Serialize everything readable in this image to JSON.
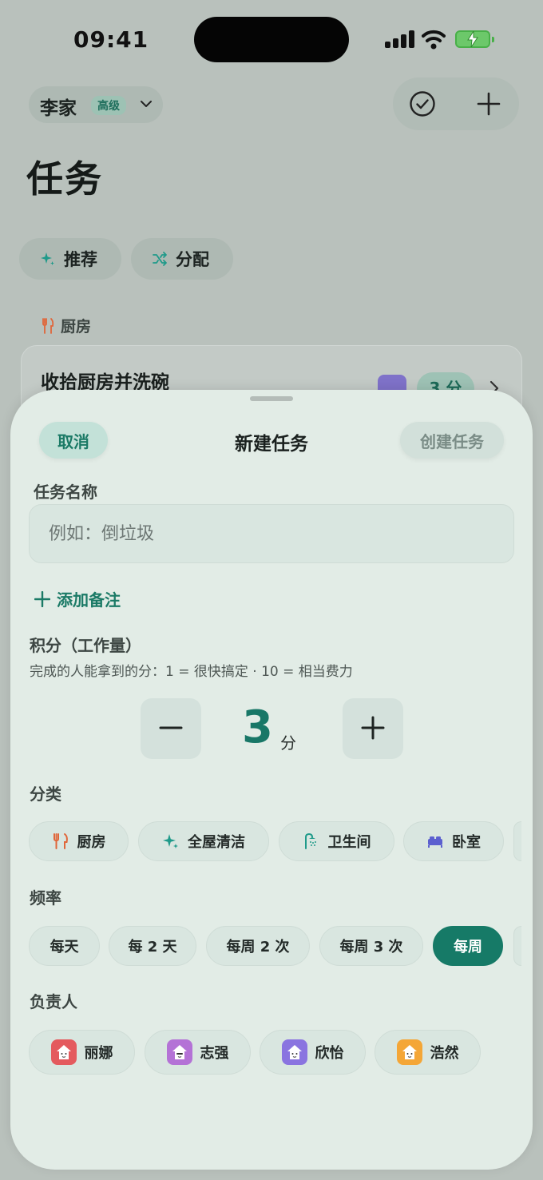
{
  "status_bar": {
    "time": "09:41"
  },
  "header": {
    "family_name": "李家",
    "tier_badge": "高级",
    "page_title": "任务"
  },
  "quick_actions": {
    "recommend_label": "推荐",
    "assign_label": "分配"
  },
  "background_list": {
    "section_title": "厨房",
    "task_title": "收拾厨房并洗碗",
    "task_points": "3 分"
  },
  "sheet": {
    "title": "新建任务",
    "cancel_label": "取消",
    "create_label": "创建任务",
    "name_label": "任务名称",
    "name_placeholder": "例如：倒垃圾",
    "name_value": "",
    "add_note_label": "添加备注",
    "points_label": "积分（工作量）",
    "points_description": "完成的人能拿到的分：1 = 很快搞定 · 10 = 相当费力",
    "points_value": "3",
    "points_unit": "分",
    "category_label": "分类",
    "categories": [
      {
        "label": "厨房",
        "icon": "fork-knife-icon",
        "color": "#e0663a"
      },
      {
        "label": "全屋清洁",
        "icon": "sparkles-icon",
        "color": "#1f9a8a"
      },
      {
        "label": "卫生间",
        "icon": "shower-icon",
        "color": "#1f9a8a"
      },
      {
        "label": "卧室",
        "icon": "bed-icon",
        "color": "#5b5fcf"
      }
    ],
    "frequency_label": "频率",
    "frequencies": [
      {
        "label": "每天",
        "selected": false
      },
      {
        "label": "每 2 天",
        "selected": false
      },
      {
        "label": "每周 2 次",
        "selected": false
      },
      {
        "label": "每周 3 次",
        "selected": false
      },
      {
        "label": "每周",
        "selected": true
      }
    ],
    "assignee_label": "负责人",
    "assignees": [
      {
        "name": "丽娜",
        "color": "#e45a5e"
      },
      {
        "name": "志强",
        "color": "#b472d6"
      },
      {
        "name": "欣怡",
        "color": "#8a74e0"
      },
      {
        "name": "浩然",
        "color": "#f4a637"
      }
    ]
  },
  "colors": {
    "accent": "#167a67",
    "sheet_background": "#e2ece6"
  }
}
